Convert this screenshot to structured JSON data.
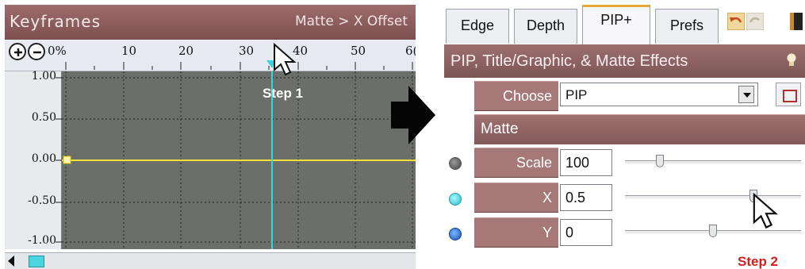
{
  "keyframes": {
    "title": "Keyframes",
    "path": "Matte > X Offset",
    "ruler": {
      "start_label": "0%",
      "marks": [
        "10",
        "20",
        "30",
        "40",
        "50",
        "6("
      ]
    },
    "y_axis": [
      "1.00",
      "0.50",
      "0.00",
      "-0.50",
      "-1.00"
    ],
    "playhead_frame": 35,
    "step_label": "Step 1"
  },
  "panel": {
    "tabs": [
      "Edge",
      "Depth",
      "PIP+",
      "Prefs"
    ],
    "active_tab": "PIP+",
    "section_title": "PIP, Title/Graphic, & Matte Effects",
    "choose": {
      "label": "Choose",
      "value": "PIP"
    },
    "matte_header": "Matte",
    "params": [
      {
        "label": "Scale",
        "value": "100",
        "slider_position": 0.2
      },
      {
        "label": "X",
        "value": "0.5",
        "slider_position": 0.73
      },
      {
        "label": "Y",
        "value": "0",
        "slider_position": 0.5
      }
    ],
    "step_label": "Step 2"
  },
  "colors": {
    "header_maroon": "#8e6060",
    "row_label_maroon": "#a77878",
    "graph_bg": "#6b6e6b",
    "curve_yellow": "#f2e23a",
    "playhead_cyan": "#39d5de",
    "step2_red": "#d22020",
    "active_tab_accent": "#e6a640"
  },
  "icons": {
    "zoom_in": "zoom-in-icon",
    "zoom_out": "zoom-out-icon",
    "undo": "undo-icon",
    "redo": "redo-icon",
    "bulb": "lightbulb-icon",
    "arrow": "right-arrow-icon",
    "cursor": "mouse-pointer-icon"
  }
}
